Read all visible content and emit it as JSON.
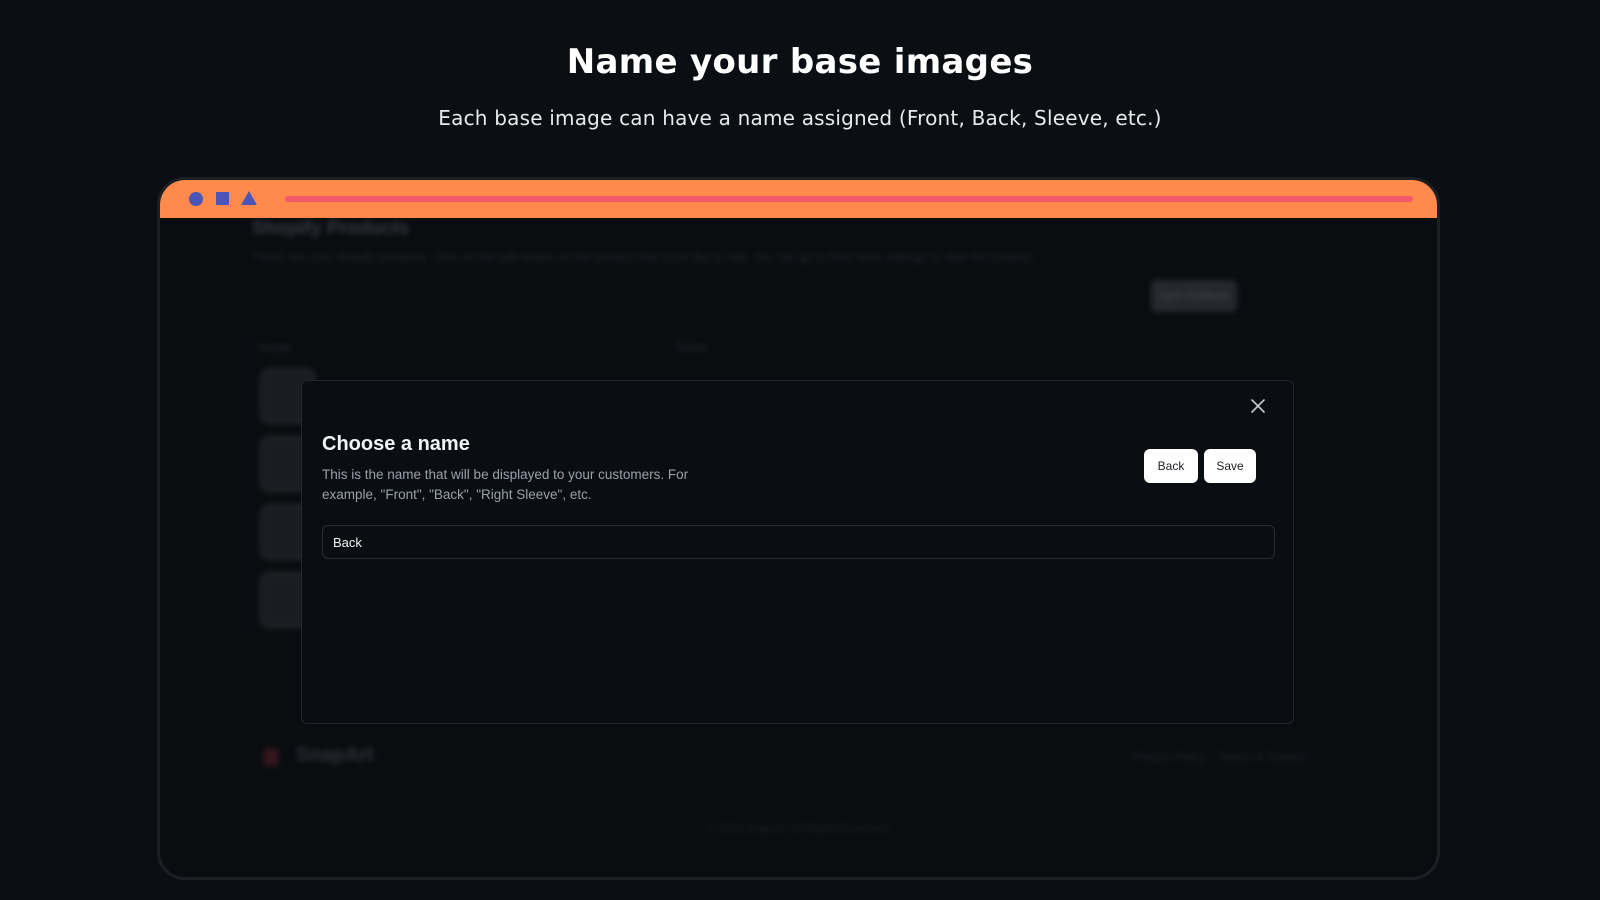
{
  "hero": {
    "title": "Name your base images",
    "subtitle": "Each base image can have a name assigned (Front, Back, Sleeve, etc.)"
  },
  "colors": {
    "browser_bar": "#ff8a4c",
    "browser_shapes": "#4b55b8",
    "url_bar": "#f25a6b",
    "background": "#0b0e12"
  },
  "background_app": {
    "page_title": "Shopify Products",
    "description": "These are your Shopify products. Click on the edit button on the product that you'd like to edit. You can go to their store settings to view the product.",
    "primary_button": "Sync Products",
    "column_image": "Image",
    "column_name": "Name",
    "footer_brand": "SnapArt",
    "footer_links": [
      "Privacy Policy",
      "Terms of Service"
    ],
    "copyright": "© 2023 SnapArt. All Rights Reserved."
  },
  "modal": {
    "title": "Choose a name",
    "description": "This is the name that will be displayed to your customers. For example, \"Front\", \"Back\", \"Right Sleeve\", etc.",
    "back_label": "Back",
    "save_label": "Save",
    "input_value": "Back",
    "close_icon": "close-icon"
  }
}
